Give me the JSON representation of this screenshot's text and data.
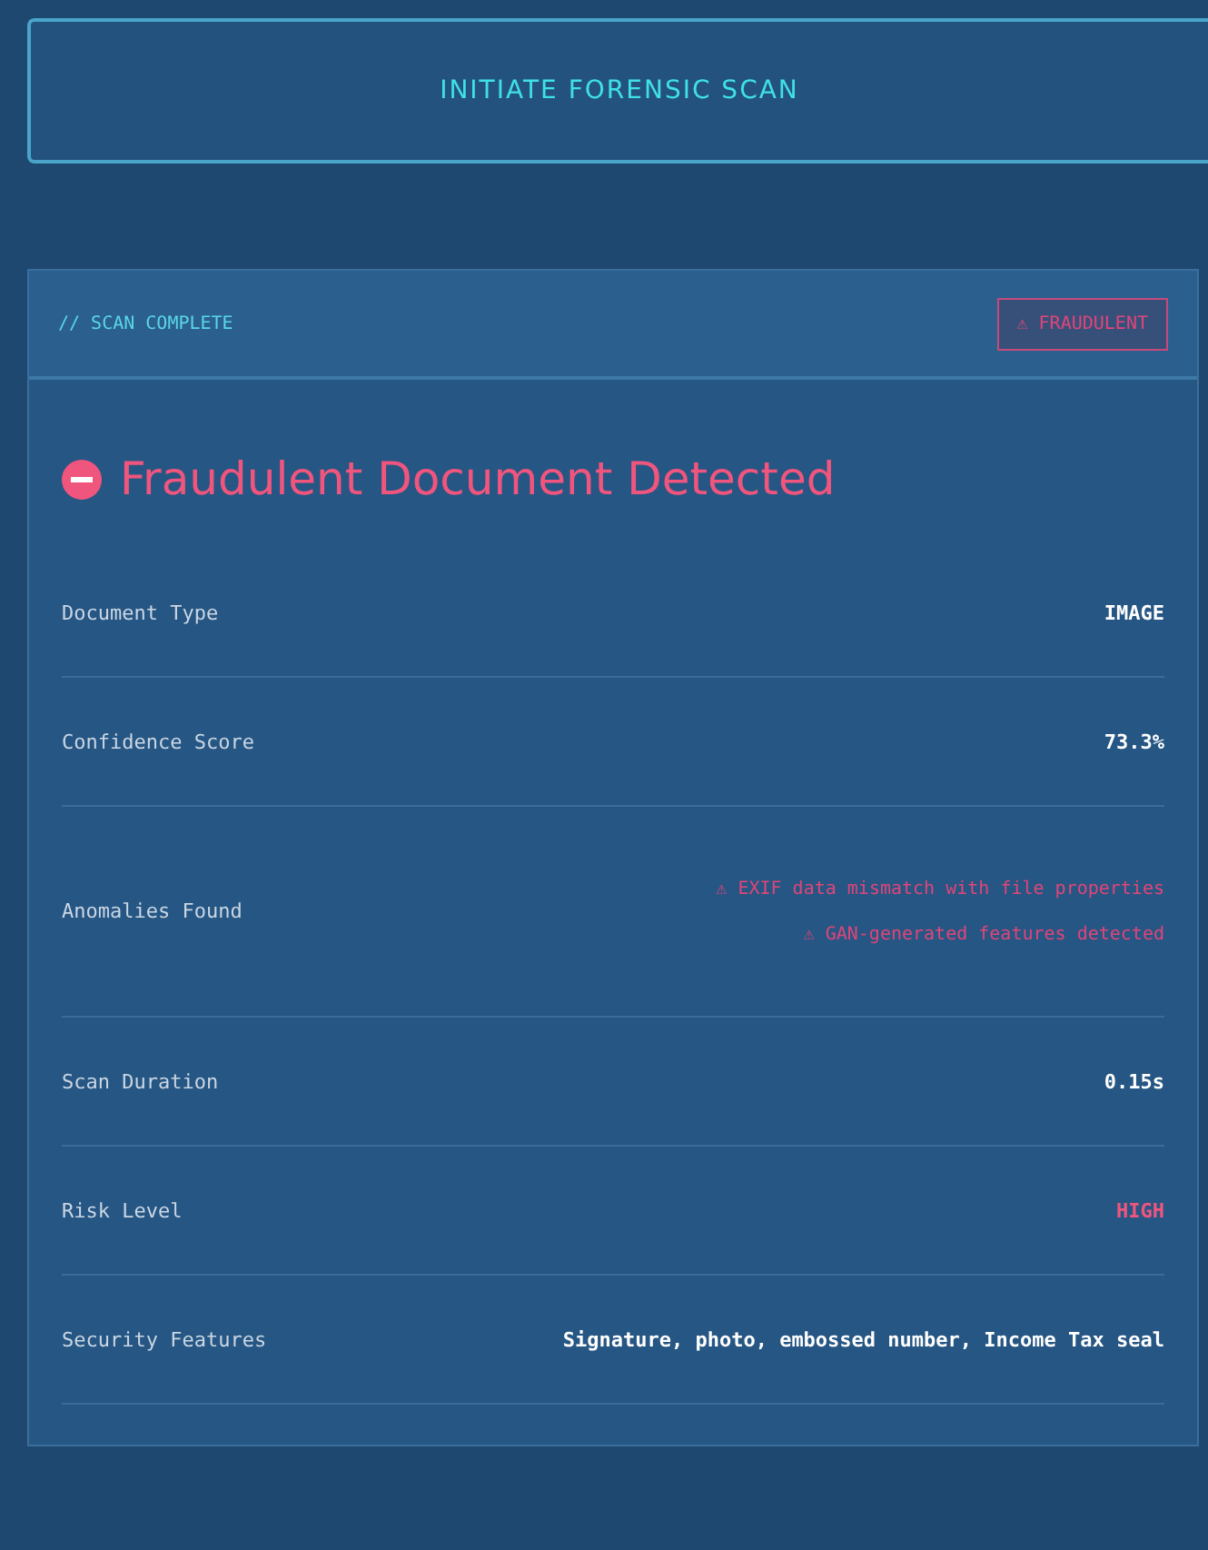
{
  "scan_button": {
    "label": "INITIATE FORENSIC SCAN"
  },
  "result": {
    "header": "// SCAN COMPLETE",
    "badge": {
      "label": "⚠ FRAUDULENT",
      "alert": true
    },
    "headline": {
      "text": "Fraudulent Document Detected",
      "alert": true
    },
    "rows": [
      {
        "label": "Document Type",
        "kind": "text",
        "value": "IMAGE"
      },
      {
        "label": "Confidence Score",
        "kind": "text",
        "value": "73.3%"
      },
      {
        "label": "Anomalies Found",
        "kind": "list",
        "items": [
          "⚠ EXIF data mismatch with file properties",
          "⚠ GAN-generated features detected"
        ]
      },
      {
        "label": "Scan Duration",
        "kind": "text",
        "value": "0.15s"
      },
      {
        "label": "Risk Level",
        "kind": "risk",
        "value": "HIGH"
      },
      {
        "label": "Security Features",
        "kind": "text",
        "value": "Signature, photo, embossed number, Income Tax seal"
      }
    ]
  }
}
